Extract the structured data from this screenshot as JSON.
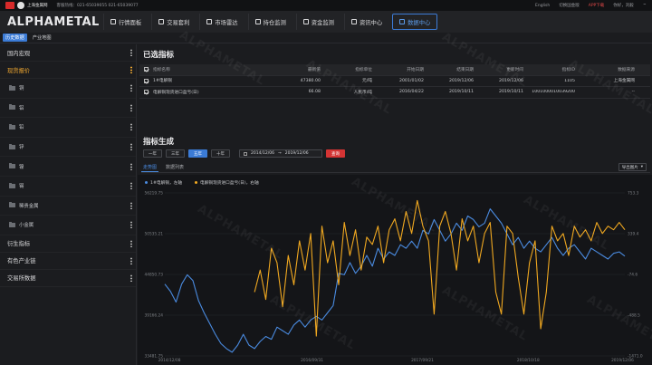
{
  "topbar": {
    "brand": "上海金属网",
    "hotline": "客服热线：021-65039055 021-65039077",
    "lang": "English",
    "switch_site": "切换国金版",
    "app": "APP下载",
    "user": "你好，刘毅"
  },
  "logo": "ALPHAMETAL",
  "nav": [
    {
      "label": "行情面板"
    },
    {
      "label": "交易套利"
    },
    {
      "label": "市场雷达"
    },
    {
      "label": "持仓监测"
    },
    {
      "label": "资金监测"
    },
    {
      "label": "资讯中心"
    },
    {
      "label": "数据中心"
    }
  ],
  "subtabs": [
    "历史数据",
    "产业地图"
  ],
  "sidebar": {
    "cats": [
      "国内宏观",
      "现货报价",
      "衍生指标",
      "有色产业链",
      "交易所数据"
    ],
    "subs": [
      "铜",
      "铝",
      "铅",
      "锌",
      "镍",
      "锡",
      "稀贵金属",
      "小金属"
    ]
  },
  "selected": {
    "title": "已选指标",
    "headers": [
      "指标名称",
      "最新值",
      "指标单位",
      "开始日期",
      "结束日期",
      "更新时间",
      "指标ID",
      "数据来源"
    ],
    "rows": [
      [
        "1#电解铜",
        "47380.00",
        "元/吨",
        "2001/01/02",
        "2019/12/06",
        "2019/12/06",
        "1105",
        "上海金属网"
      ],
      [
        "电解铜现货进口盈亏(日)",
        "66.08",
        "人民币/吨",
        "2016/04/22",
        "2019/10/11",
        "2019/10/11",
        "1001000010039200",
        "--"
      ]
    ]
  },
  "gen": {
    "title": "指标生成",
    "ranges": [
      "一年",
      "三年",
      "五年",
      "十年"
    ],
    "date_from": "2014/12/06",
    "date_sep": "→",
    "date_to": "2019/12/06",
    "query": "查询",
    "tab_chart": "走势图",
    "tab_list": "数据列表",
    "export": "导出图片"
  },
  "chart_data": {
    "type": "line",
    "xticks": [
      "2014/12/08",
      "2016/09/31",
      "2017/09/21",
      "2018/10/18",
      "2019/12/06"
    ],
    "yleft_ticks": [
      "56219.75",
      "50535.21",
      "44850.73",
      "39166.24",
      "33481.75"
    ],
    "yright_ticks": [
      "753.3",
      "339.4",
      "-74.6",
      "-488.5",
      "-1471.0"
    ],
    "yleft_range": [
      33481.75,
      56219.75
    ],
    "yright_range": [
      -1471.0,
      753.3
    ],
    "series": [
      {
        "name": "1#电解铜，左轴",
        "color": "#4a8be0",
        "axis": "left",
        "values": [
          43500,
          42500,
          41000,
          43500,
          44800,
          44000,
          41200,
          39500,
          38000,
          36500,
          35200,
          34500,
          34000,
          35000,
          36500,
          35000,
          34500,
          35500,
          36200,
          35800,
          37500,
          37000,
          36500,
          37800,
          38500,
          37500,
          38500,
          39000,
          38500,
          39500,
          40500,
          45000,
          44800,
          46500,
          45000,
          46000,
          47500,
          46000,
          48500,
          47000,
          48000,
          47500,
          49000,
          48500,
          49500,
          48500,
          51000,
          50500,
          52500,
          51000,
          49500,
          50500,
          52000,
          51000,
          53000,
          52500,
          51500,
          52000,
          54000,
          53000,
          52000,
          50500,
          49000,
          50000,
          48500,
          49500,
          48500,
          48000,
          49000,
          50000,
          48500,
          47500,
          48500,
          49000,
          48000,
          47000,
          48500,
          48000,
          47500,
          47000,
          47800,
          48000,
          47400
        ]
      },
      {
        "name": "电解铜现货进口盈亏(日)，右轴",
        "color": "#f0a820",
        "axis": "right",
        "values": [
          null,
          null,
          null,
          null,
          null,
          null,
          null,
          null,
          null,
          null,
          null,
          null,
          null,
          null,
          null,
          null,
          -600,
          -300,
          -700,
          0,
          -200,
          -800,
          -100,
          -500,
          100,
          -300,
          200,
          -1200,
          300,
          -200,
          100,
          -500,
          350,
          -100,
          250,
          -300,
          150,
          50,
          300,
          -200,
          250,
          400,
          100,
          500,
          200,
          650,
          300,
          100,
          -900,
          300,
          500,
          200,
          -300,
          400,
          100,
          300,
          -200,
          200,
          350,
          -600,
          -900,
          300,
          200,
          -400,
          -900,
          -200,
          100,
          -1100,
          -600,
          300,
          100,
          200,
          -100,
          300,
          150,
          250,
          100,
          350,
          200,
          300,
          250,
          350,
          250
        ]
      }
    ]
  },
  "watermarks": [
    "ALPHAMETAL"
  ]
}
